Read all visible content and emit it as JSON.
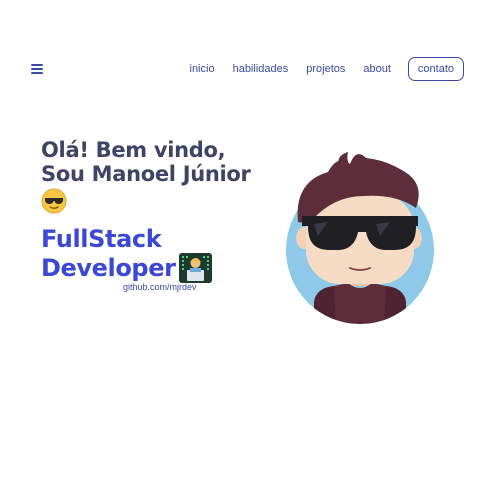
{
  "nav": {
    "links": [
      "inicio",
      "habilidades",
      "projetos",
      "about"
    ],
    "cta": "contato"
  },
  "hero": {
    "greeting_line1": "Olá! Bem vindo,",
    "greeting_line2": "Sou Manoel Júnior",
    "role_line1": "FullStack",
    "role_line2": "Developer",
    "github": "github.com/mjrdev"
  },
  "icons": {
    "menu": "hamburger-icon",
    "greeting_emoji": "sunglasses-face-emoji",
    "role_emoji": "technologist-emoji",
    "avatar": "developer-avatar-illustration"
  },
  "colors": {
    "accent": "#3a4aa8",
    "heading": "#3f4467",
    "role": "#3b48d6",
    "avatar_bg": "#8ec9ea"
  }
}
